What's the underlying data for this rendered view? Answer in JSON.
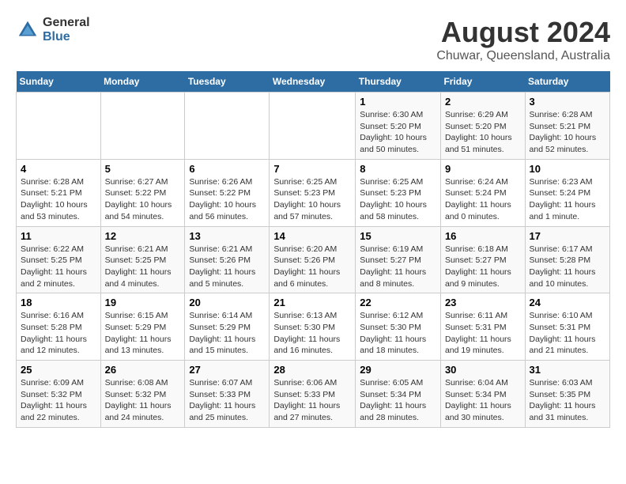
{
  "header": {
    "logo_general": "General",
    "logo_blue": "Blue",
    "title": "August 2024",
    "subtitle": "Chuwar, Queensland, Australia"
  },
  "days_of_week": [
    "Sunday",
    "Monday",
    "Tuesday",
    "Wednesday",
    "Thursday",
    "Friday",
    "Saturday"
  ],
  "weeks": [
    [
      {
        "day": "",
        "sunrise": "",
        "sunset": "",
        "daylight": ""
      },
      {
        "day": "",
        "sunrise": "",
        "sunset": "",
        "daylight": ""
      },
      {
        "day": "",
        "sunrise": "",
        "sunset": "",
        "daylight": ""
      },
      {
        "day": "",
        "sunrise": "",
        "sunset": "",
        "daylight": ""
      },
      {
        "day": "1",
        "sunrise": "Sunrise: 6:30 AM",
        "sunset": "Sunset: 5:20 PM",
        "daylight": "Daylight: 10 hours and 50 minutes."
      },
      {
        "day": "2",
        "sunrise": "Sunrise: 6:29 AM",
        "sunset": "Sunset: 5:20 PM",
        "daylight": "Daylight: 10 hours and 51 minutes."
      },
      {
        "day": "3",
        "sunrise": "Sunrise: 6:28 AM",
        "sunset": "Sunset: 5:21 PM",
        "daylight": "Daylight: 10 hours and 52 minutes."
      }
    ],
    [
      {
        "day": "4",
        "sunrise": "Sunrise: 6:28 AM",
        "sunset": "Sunset: 5:21 PM",
        "daylight": "Daylight: 10 hours and 53 minutes."
      },
      {
        "day": "5",
        "sunrise": "Sunrise: 6:27 AM",
        "sunset": "Sunset: 5:22 PM",
        "daylight": "Daylight: 10 hours and 54 minutes."
      },
      {
        "day": "6",
        "sunrise": "Sunrise: 6:26 AM",
        "sunset": "Sunset: 5:22 PM",
        "daylight": "Daylight: 10 hours and 56 minutes."
      },
      {
        "day": "7",
        "sunrise": "Sunrise: 6:25 AM",
        "sunset": "Sunset: 5:23 PM",
        "daylight": "Daylight: 10 hours and 57 minutes."
      },
      {
        "day": "8",
        "sunrise": "Sunrise: 6:25 AM",
        "sunset": "Sunset: 5:23 PM",
        "daylight": "Daylight: 10 hours and 58 minutes."
      },
      {
        "day": "9",
        "sunrise": "Sunrise: 6:24 AM",
        "sunset": "Sunset: 5:24 PM",
        "daylight": "Daylight: 11 hours and 0 minutes."
      },
      {
        "day": "10",
        "sunrise": "Sunrise: 6:23 AM",
        "sunset": "Sunset: 5:24 PM",
        "daylight": "Daylight: 11 hours and 1 minute."
      }
    ],
    [
      {
        "day": "11",
        "sunrise": "Sunrise: 6:22 AM",
        "sunset": "Sunset: 5:25 PM",
        "daylight": "Daylight: 11 hours and 2 minutes."
      },
      {
        "day": "12",
        "sunrise": "Sunrise: 6:21 AM",
        "sunset": "Sunset: 5:25 PM",
        "daylight": "Daylight: 11 hours and 4 minutes."
      },
      {
        "day": "13",
        "sunrise": "Sunrise: 6:21 AM",
        "sunset": "Sunset: 5:26 PM",
        "daylight": "Daylight: 11 hours and 5 minutes."
      },
      {
        "day": "14",
        "sunrise": "Sunrise: 6:20 AM",
        "sunset": "Sunset: 5:26 PM",
        "daylight": "Daylight: 11 hours and 6 minutes."
      },
      {
        "day": "15",
        "sunrise": "Sunrise: 6:19 AM",
        "sunset": "Sunset: 5:27 PM",
        "daylight": "Daylight: 11 hours and 8 minutes."
      },
      {
        "day": "16",
        "sunrise": "Sunrise: 6:18 AM",
        "sunset": "Sunset: 5:27 PM",
        "daylight": "Daylight: 11 hours and 9 minutes."
      },
      {
        "day": "17",
        "sunrise": "Sunrise: 6:17 AM",
        "sunset": "Sunset: 5:28 PM",
        "daylight": "Daylight: 11 hours and 10 minutes."
      }
    ],
    [
      {
        "day": "18",
        "sunrise": "Sunrise: 6:16 AM",
        "sunset": "Sunset: 5:28 PM",
        "daylight": "Daylight: 11 hours and 12 minutes."
      },
      {
        "day": "19",
        "sunrise": "Sunrise: 6:15 AM",
        "sunset": "Sunset: 5:29 PM",
        "daylight": "Daylight: 11 hours and 13 minutes."
      },
      {
        "day": "20",
        "sunrise": "Sunrise: 6:14 AM",
        "sunset": "Sunset: 5:29 PM",
        "daylight": "Daylight: 11 hours and 15 minutes."
      },
      {
        "day": "21",
        "sunrise": "Sunrise: 6:13 AM",
        "sunset": "Sunset: 5:30 PM",
        "daylight": "Daylight: 11 hours and 16 minutes."
      },
      {
        "day": "22",
        "sunrise": "Sunrise: 6:12 AM",
        "sunset": "Sunset: 5:30 PM",
        "daylight": "Daylight: 11 hours and 18 minutes."
      },
      {
        "day": "23",
        "sunrise": "Sunrise: 6:11 AM",
        "sunset": "Sunset: 5:31 PM",
        "daylight": "Daylight: 11 hours and 19 minutes."
      },
      {
        "day": "24",
        "sunrise": "Sunrise: 6:10 AM",
        "sunset": "Sunset: 5:31 PM",
        "daylight": "Daylight: 11 hours and 21 minutes."
      }
    ],
    [
      {
        "day": "25",
        "sunrise": "Sunrise: 6:09 AM",
        "sunset": "Sunset: 5:32 PM",
        "daylight": "Daylight: 11 hours and 22 minutes."
      },
      {
        "day": "26",
        "sunrise": "Sunrise: 6:08 AM",
        "sunset": "Sunset: 5:32 PM",
        "daylight": "Daylight: 11 hours and 24 minutes."
      },
      {
        "day": "27",
        "sunrise": "Sunrise: 6:07 AM",
        "sunset": "Sunset: 5:33 PM",
        "daylight": "Daylight: 11 hours and 25 minutes."
      },
      {
        "day": "28",
        "sunrise": "Sunrise: 6:06 AM",
        "sunset": "Sunset: 5:33 PM",
        "daylight": "Daylight: 11 hours and 27 minutes."
      },
      {
        "day": "29",
        "sunrise": "Sunrise: 6:05 AM",
        "sunset": "Sunset: 5:34 PM",
        "daylight": "Daylight: 11 hours and 28 minutes."
      },
      {
        "day": "30",
        "sunrise": "Sunrise: 6:04 AM",
        "sunset": "Sunset: 5:34 PM",
        "daylight": "Daylight: 11 hours and 30 minutes."
      },
      {
        "day": "31",
        "sunrise": "Sunrise: 6:03 AM",
        "sunset": "Sunset: 5:35 PM",
        "daylight": "Daylight: 11 hours and 31 minutes."
      }
    ]
  ]
}
